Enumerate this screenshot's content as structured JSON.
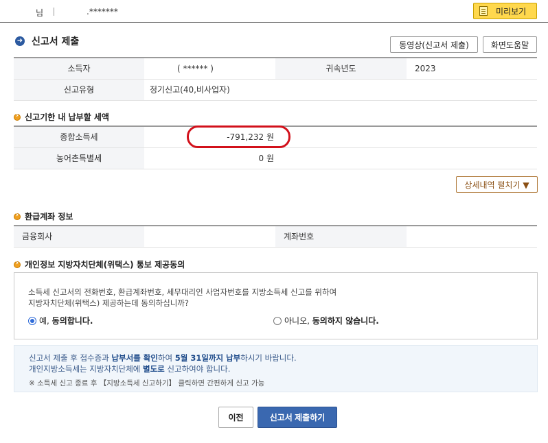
{
  "header": {
    "user_name": "님",
    "user_id": ".*******",
    "preview_label": "미리보기"
  },
  "section": {
    "title": "신고서 제출",
    "video_label": "동영상(신고서 제출)",
    "help_label": "화면도움말"
  },
  "info_table": {
    "income_earner_label": "소득자",
    "income_earner_value": "(                  ******  )",
    "year_label": "귀속년도",
    "year_value": "2023",
    "type_label": "신고유형",
    "type_value": "정기신고(40,비사업자)"
  },
  "payment": {
    "title": "신고기한 내 납부할 세액",
    "rows": [
      {
        "label": "종합소득세",
        "value": "-791,232 원"
      },
      {
        "label": "농어촌특별세",
        "value": "0 원"
      }
    ],
    "detail_label": "상세내역 펼치기 ▼"
  },
  "refund": {
    "title": "환급계좌 정보",
    "bank_label": "금융회사",
    "account_label": "계좌번호"
  },
  "consent": {
    "title": "개인정보 지방자치단체(위택스) 통보 제공동의",
    "text_line1": "소득세 신고서의 전화번호, 환급계좌번호, 세무대리인 사업자번호를 지방소득세 신고를 위하여",
    "text_line2": "지방자치단체(위택스) 제공하는데 동의하십니까?",
    "yes_prefix": "예, ",
    "yes_bold": "동의합니다.",
    "no_prefix": "아니오, ",
    "no_bold": "동의하지 않습니다."
  },
  "notice": {
    "line1_a": "신고서 제출 후 접수증과 ",
    "line1_b": "납부서를 확인",
    "line1_c": "하여 ",
    "line1_d": "5월 31일까지 납부",
    "line1_e": "하시기 바랍니다.",
    "line2_a": "개인지방소득세는 지방자치단체에 ",
    "line2_b": "별도로",
    "line2_c": " 신고하여야 합니다.",
    "line3": "※ 소득세 신고 종료 후 【지방소득세 신고하기】 클릭하면 간편하게 신고 가능"
  },
  "actions": {
    "prev_label": "이전",
    "submit_label": "신고서 제출하기"
  }
}
